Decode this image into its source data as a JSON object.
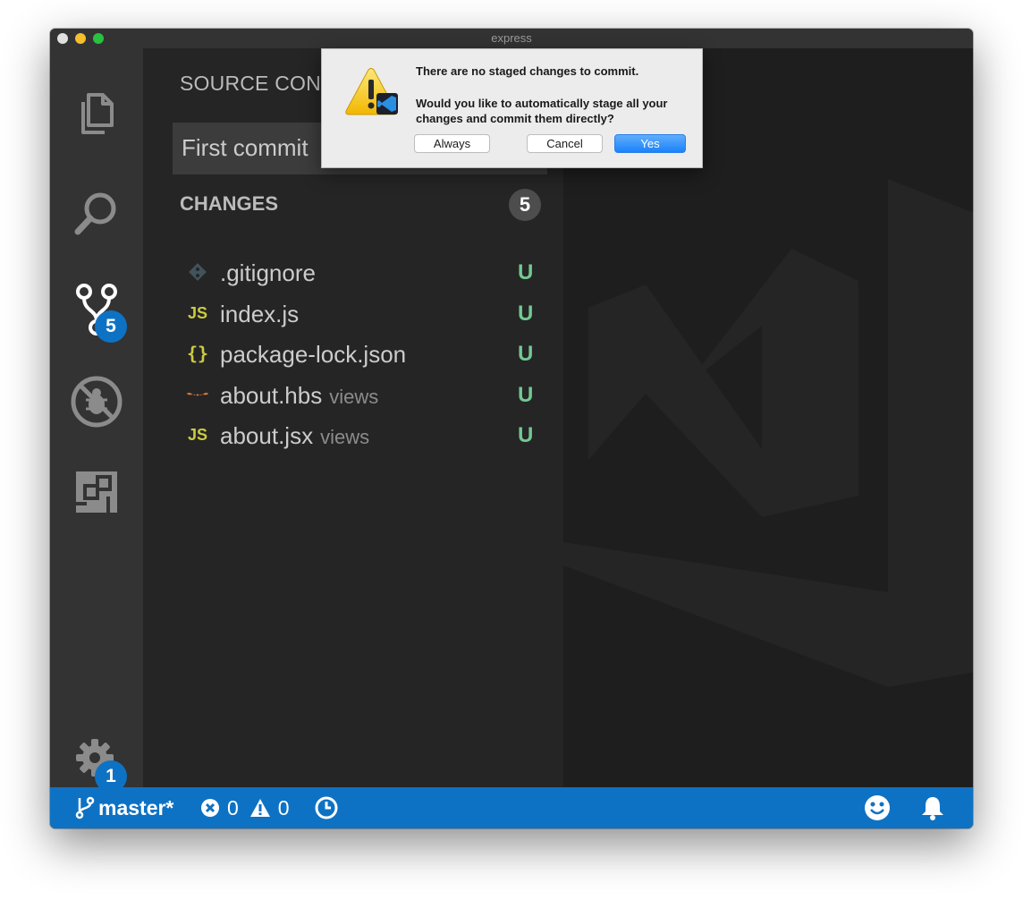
{
  "window": {
    "title": "express"
  },
  "activity_bar": {
    "items": [
      {
        "name": "explorer",
        "icon": "files-icon"
      },
      {
        "name": "search",
        "icon": "search-icon"
      },
      {
        "name": "source-control",
        "icon": "source-control-icon",
        "badge": "5"
      },
      {
        "name": "debug",
        "icon": "debug-icon"
      },
      {
        "name": "extensions",
        "icon": "extensions-icon"
      }
    ],
    "manage": {
      "icon": "gear-icon",
      "badge": "1"
    }
  },
  "sidebar": {
    "title": "SOURCE CONTROL: GIT",
    "commit_message": "First commit",
    "changes_label": "CHANGES",
    "changes_count": "5",
    "files": [
      {
        "name": ".gitignore",
        "dir": "",
        "icon": "git-file-icon",
        "status": "U"
      },
      {
        "name": "index.js",
        "dir": "",
        "icon": "js-file-icon",
        "status": "U"
      },
      {
        "name": "package-lock.json",
        "dir": "",
        "icon": "json-file-icon",
        "status": "U"
      },
      {
        "name": "about.hbs",
        "dir": "views",
        "icon": "handlebars-file-icon",
        "status": "U"
      },
      {
        "name": "about.jsx",
        "dir": "views",
        "icon": "js-file-icon",
        "status": "U"
      }
    ]
  },
  "status_bar": {
    "branch": "master*",
    "errors": "0",
    "warnings": "0",
    "color": "#0e72c4"
  },
  "dialog": {
    "title": "There are no staged changes to commit.",
    "message": "Would you like to automatically stage all your changes and commit them directly?",
    "buttons": {
      "always": "Always",
      "cancel": "Cancel",
      "yes": "Yes"
    }
  },
  "colors": {
    "untracked": "#73c991",
    "badge": "#0e72c4",
    "js": "#cbcb41",
    "hbs": "#e37933"
  }
}
